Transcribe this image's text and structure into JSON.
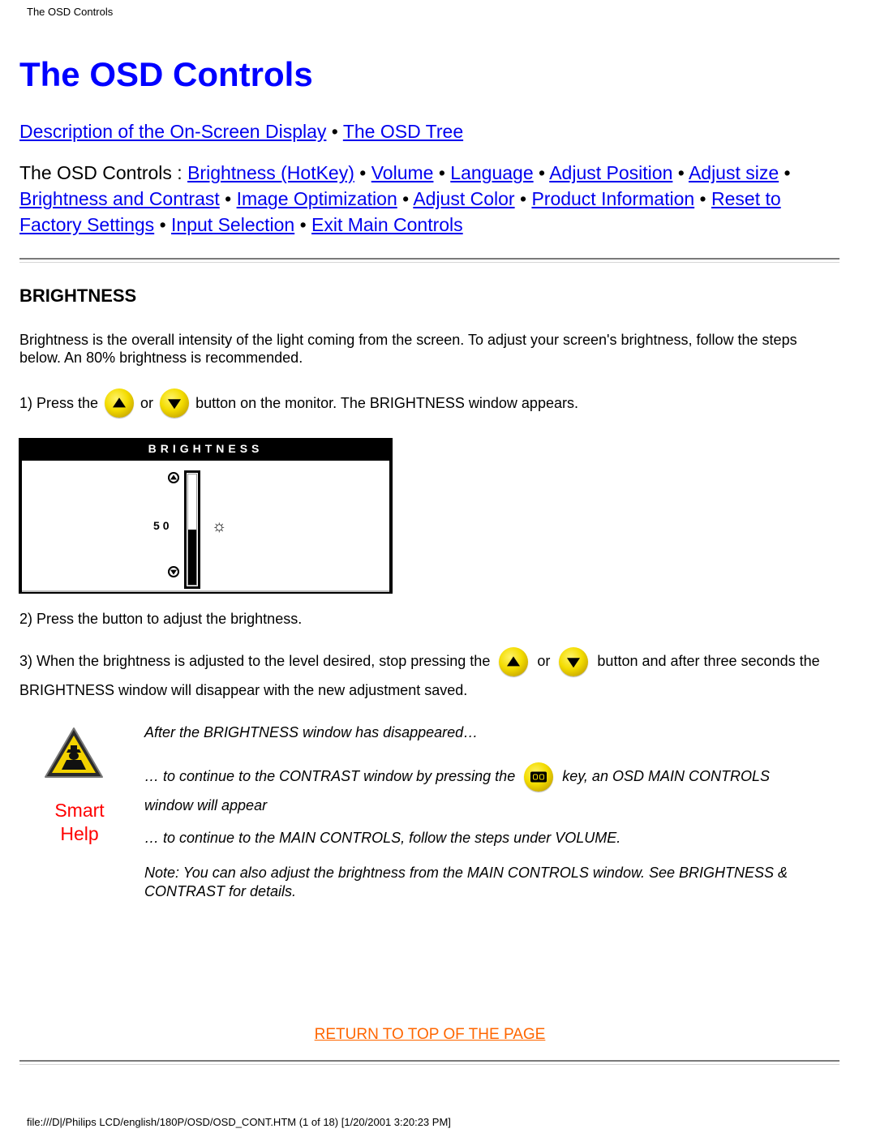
{
  "page_header": "The OSD Controls",
  "title": "The OSD Controls",
  "nav_primary": [
    {
      "label": "Description of the On-Screen Display"
    },
    {
      "label": "The OSD Tree"
    }
  ],
  "nav_secondary": {
    "prefix": "The OSD Controls : ",
    "links": [
      {
        "label": "Brightness (HotKey)"
      },
      {
        "label": "Volume"
      },
      {
        "label": "Language"
      },
      {
        "label": "Adjust Position"
      },
      {
        "label": "Adjust size"
      },
      {
        "label": "Brightness and Contrast"
      },
      {
        "label": "Image Optimization"
      },
      {
        "label": "Adjust Color"
      },
      {
        "label": "Product Information"
      },
      {
        "label": "Reset to Factory Settings"
      },
      {
        "label": "Input Selection"
      },
      {
        "label": "Exit Main Controls"
      }
    ],
    "separator": "•"
  },
  "section": {
    "heading": "BRIGHTNESS",
    "intro": "Brightness is the overall intensity of the light coming from the screen. To adjust your screen's brightness, follow the steps below. An 80% brightness is recommended.",
    "step1": {
      "before": "1) Press the",
      "or": "or",
      "after": "button on the monitor. The BRIGHTNESS window appears.",
      "icons": [
        "up-button-icon",
        "down-button-icon"
      ]
    },
    "osd_window": {
      "title": "BRIGHTNESS",
      "value": "50",
      "level_fraction": 0.5,
      "icons": [
        "up-arrow-icon",
        "down-arrow-icon",
        "sun-icon"
      ]
    },
    "step2": "2) Press the button to adjust the brightness.",
    "step3": {
      "before": "3) When the brightness is adjusted to the level desired, stop pressing the",
      "or": "or",
      "after": "button and after three seconds the BRIGHTNESS window will disappear with the new adjustment saved."
    }
  },
  "smart_help": {
    "label_line1": "Smart",
    "label_line2": "Help",
    "lines": [
      "After the BRIGHTNESS window has disappeared…",
      "… to continue to the CONTRAST window by pressing the",
      "key, an OSD MAIN CONTROLS window will appear",
      "… to continue to the MAIN CONTROLS, follow the steps under VOLUME.",
      "Note: You can also adjust the brightness from the MAIN CONTROLS window. See BRIGHTNESS & CONTRAST for details."
    ]
  },
  "return_link": "RETURN TO TOP OF THE PAGE",
  "footer": "file:///D|/Philips LCD/english/180P/OSD/OSD_CONT.HTM (1 of 18) [1/20/2001 3:20:23 PM]",
  "colors": {
    "title": "#0000ff",
    "link": "#0000ee",
    "smart_help": "#ff0000",
    "return_link": "#ff6600",
    "button_yellow": "#f3dc00"
  }
}
